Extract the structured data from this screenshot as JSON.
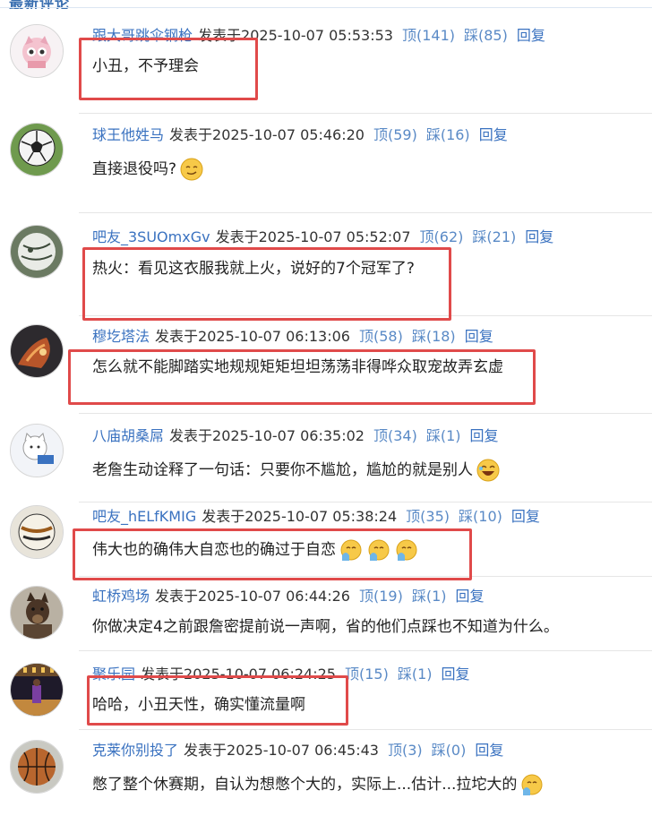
{
  "colors": {
    "link": "#3a72c0",
    "highlight": "#e04a4a",
    "text": "#222222"
  },
  "header": {
    "title": "最新评论"
  },
  "comments": [
    {
      "user": "跟大哥跳伞钢枪",
      "posted": "发表于",
      "time": "2025-10-07 05:53:53",
      "up": "顶(141)",
      "down": "踩(85)",
      "reply": "回复",
      "text": "小丑，不予理会",
      "avatar_icon": "pink-cat-avatar",
      "emojis": []
    },
    {
      "user": "球王他姓马",
      "posted": "发表于",
      "time": "2025-10-07 05:46:20",
      "up": "顶(59)",
      "down": "踩(16)",
      "reply": "回复",
      "text": "直接退役吗?",
      "avatar_icon": "soccer-ball-avatar",
      "emojis": [
        "smirk-emoji"
      ]
    },
    {
      "user": "吧友_3SUOmxGv",
      "posted": "发表于",
      "time": "2025-10-07 05:52:07",
      "up": "顶(62)",
      "down": "踩(21)",
      "reply": "回复",
      "text": "热火：看见这衣服我就上火，说好的7个冠军了?",
      "avatar_icon": "ball-avatar",
      "emojis": []
    },
    {
      "user": "穆圪塔法",
      "posted": "发表于",
      "time": "2025-10-07 06:13:06",
      "up": "顶(58)",
      "down": "踩(18)",
      "reply": "回复",
      "text": "怎么就不能脚踏实地规规矩矩坦坦荡荡非得哗众取宠故弄玄虚",
      "avatar_icon": "dark-art-avatar",
      "emojis": []
    },
    {
      "user": "八庙胡桑屌",
      "posted": "发表于",
      "time": "2025-10-07 06:35:02",
      "up": "顶(34)",
      "down": "踩(1)",
      "reply": "回复",
      "text": "老詹生动诠释了一句话：只要你不尴尬，尴尬的就是别人",
      "avatar_icon": "cartoon-cat-avatar",
      "emojis": [
        "laugh-emoji"
      ]
    },
    {
      "user": "吧友_hELfKMIG",
      "posted": "发表于",
      "time": "2025-10-07 05:38:24",
      "up": "顶(35)",
      "down": "踩(10)",
      "reply": "回复",
      "text": "伟大也的确伟大自恋也的确过于自恋",
      "avatar_icon": "volleyball-avatar",
      "emojis": [
        "wave-emoji",
        "wave-emoji",
        "wave-emoji"
      ]
    },
    {
      "user": "虹桥鸡场",
      "posted": "发表于",
      "time": "2025-10-07 06:44:26",
      "up": "顶(19)",
      "down": "踩(1)",
      "reply": "回复",
      "text": "你做决定4之前跟詹密提前说一声啊，省的他们点踩也不知道为什么。",
      "avatar_icon": "dog-avatar",
      "emojis": []
    },
    {
      "user": "聚乐园",
      "posted": "发表于",
      "time": "2025-10-07 06:24:25",
      "up": "顶(15)",
      "down": "踩(1)",
      "reply": "回复",
      "text": "哈哈，小丑天性，确实懂流量啊",
      "avatar_icon": "arena-avatar",
      "emojis": []
    },
    {
      "user": "克莱你别投了",
      "posted": "发表于",
      "time": "2025-10-07 06:45:43",
      "up": "顶(3)",
      "down": "踩(0)",
      "reply": "回复",
      "text": "憋了整个休赛期，自认为想憋个大的，实际上...估计...拉坨大的",
      "avatar_icon": "basketball-avatar",
      "emojis": [
        "wave-emoji"
      ]
    }
  ]
}
